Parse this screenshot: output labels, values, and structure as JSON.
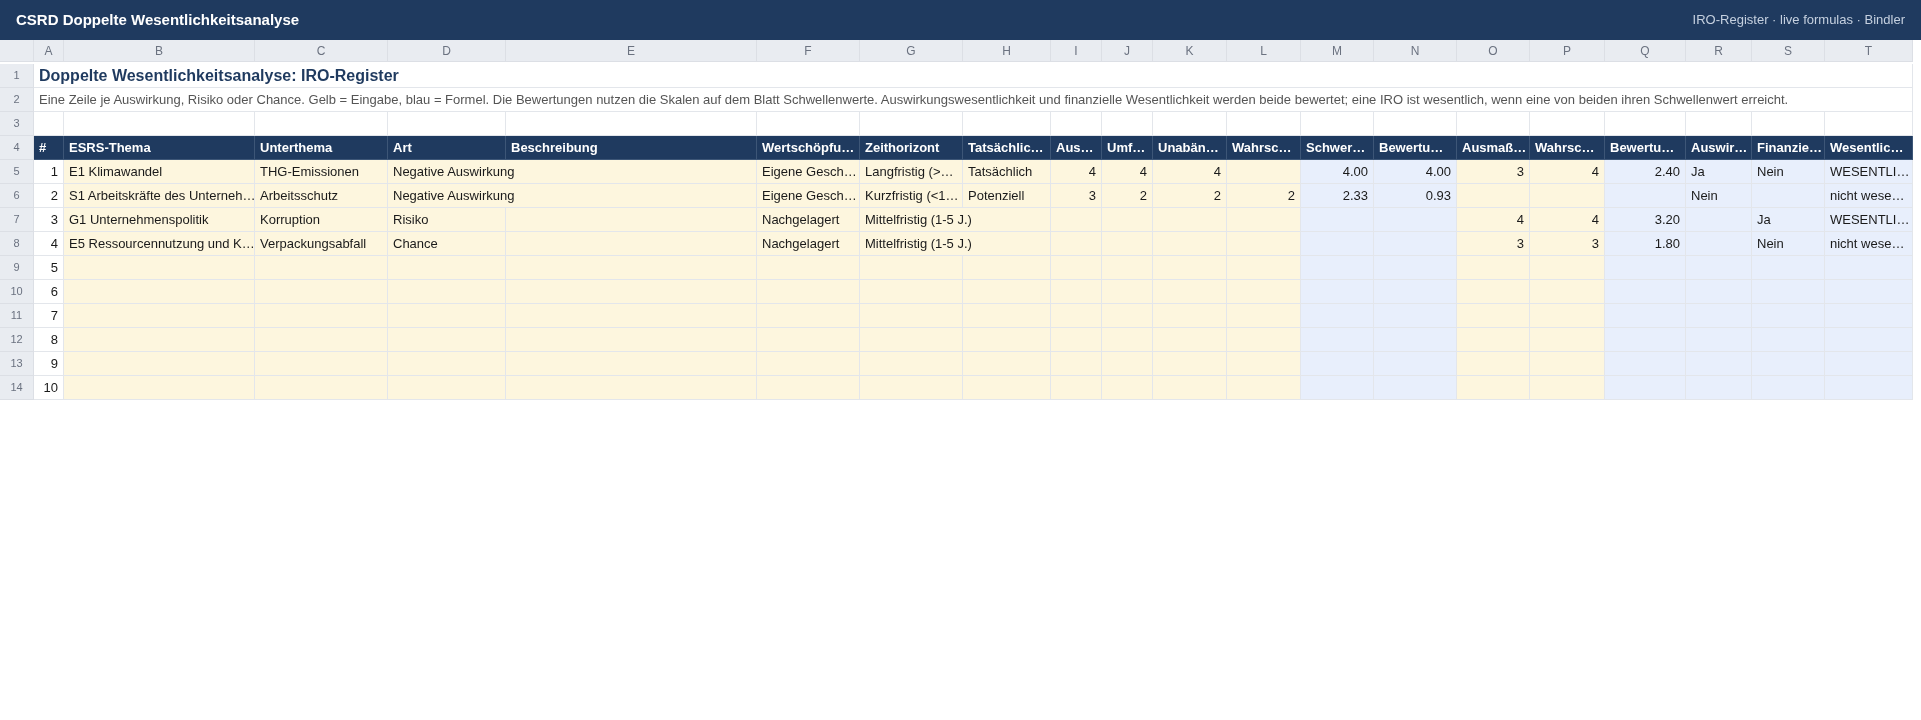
{
  "app_bar": {
    "title": "CSRD Doppelte Wesentlichkeitsanalyse",
    "subtitle": "IRO-Register · live formulas · Bindler"
  },
  "columns": [
    {
      "letter": "A",
      "header": "#",
      "kind": "index",
      "numeric": true
    },
    {
      "letter": "B",
      "header": "ESRS-Thema",
      "kind": "input",
      "numeric": false
    },
    {
      "letter": "C",
      "header": "Unterthema",
      "kind": "input",
      "numeric": false
    },
    {
      "letter": "D",
      "header": "Art",
      "kind": "input",
      "numeric": false
    },
    {
      "letter": "E",
      "header": "Beschreibung",
      "kind": "input",
      "numeric": false
    },
    {
      "letter": "F",
      "header": "Wertschöpfu…",
      "kind": "input",
      "numeric": false
    },
    {
      "letter": "G",
      "header": "Zeithorizont",
      "kind": "input",
      "numeric": false
    },
    {
      "letter": "H",
      "header": "Tatsächlic…",
      "kind": "input",
      "numeric": false
    },
    {
      "letter": "I",
      "header": "Aus…",
      "kind": "input",
      "numeric": true
    },
    {
      "letter": "J",
      "header": "Umf…",
      "kind": "input",
      "numeric": true
    },
    {
      "letter": "K",
      "header": "Unabän…",
      "kind": "input",
      "numeric": true
    },
    {
      "letter": "L",
      "header": "Wahrsc…",
      "kind": "input",
      "numeric": true
    },
    {
      "letter": "M",
      "header": "Schwer…",
      "kind": "formula",
      "numeric": true
    },
    {
      "letter": "N",
      "header": "Bewertu…",
      "kind": "formula",
      "numeric": true
    },
    {
      "letter": "O",
      "header": "Ausmaß…",
      "kind": "input",
      "numeric": true
    },
    {
      "letter": "P",
      "header": "Wahrsc…",
      "kind": "input",
      "numeric": true
    },
    {
      "letter": "Q",
      "header": "Bewertu…",
      "kind": "formula",
      "numeric": true
    },
    {
      "letter": "R",
      "header": "Auswir…",
      "kind": "formula",
      "numeric": false
    },
    {
      "letter": "S",
      "header": "Finanzie…",
      "kind": "formula",
      "numeric": false
    },
    {
      "letter": "T",
      "header": "Wesentlic…",
      "kind": "formula",
      "numeric": false
    }
  ],
  "top_rows": [
    {
      "number": "1",
      "kind": "title",
      "text": "Doppelte Wesentlichkeitsanalyse: IRO-Register"
    },
    {
      "number": "2",
      "kind": "note",
      "text": "Eine Zeile je Auswirkung, Risiko oder Chance. Gelb = Eingabe, blau = Formel. Die Bewertungen nutzen die Skalen auf dem Blatt Schwellenwerte. Auswirkungswesentlichkeit und finanzielle Wesentlichkeit werden beide bewertet; eine IRO ist wesentlich, wenn eine von beiden ihren Schwellenwert erreicht."
    },
    {
      "number": "3",
      "kind": "blank"
    },
    {
      "number": "4",
      "kind": "header"
    }
  ],
  "rows": [
    {
      "number": "5",
      "cells": {
        "A": "1",
        "B": "E1 Klimawandel",
        "C": "THG-Emissionen",
        "D": "Negative Auswirkung",
        "F": "Eigene Gesch…",
        "G": "Langfristig (>…",
        "H": "Tatsächlich",
        "I": "4",
        "J": "4",
        "K": "4",
        "M": "4.00",
        "N": "4.00",
        "O": "3",
        "P": "4",
        "Q": "2.40",
        "R": "Ja",
        "S": "Nein",
        "T": "WESENTLI…"
      }
    },
    {
      "number": "6",
      "cells": {
        "A": "2",
        "B": "S1 Arbeitskräfte des Unterneh…",
        "C": "Arbeitsschutz",
        "D": "Negative Auswirkung",
        "F": "Eigene Gesch…",
        "G": "Kurzfristig (<1…",
        "H": "Potenziell",
        "I": "3",
        "J": "2",
        "K": "2",
        "L": "2",
        "M": "2.33",
        "N": "0.93",
        "R": "Nein",
        "T": "nicht wese…"
      }
    },
    {
      "number": "7",
      "cells": {
        "A": "3",
        "B": "G1 Unternehmenspolitik",
        "C": "Korruption",
        "D": "Risiko",
        "F": "Nachgelagert",
        "G": "Mittelfristig (1-5 J.)",
        "O": "4",
        "P": "4",
        "Q": "3.20",
        "S": "Ja",
        "T": "WESENTLI…"
      }
    },
    {
      "number": "8",
      "cells": {
        "A": "4",
        "B": "E5 Ressourcennutzung und K…",
        "C": "Verpackungsabfall",
        "D": "Chance",
        "F": "Nachgelagert",
        "G": "Mittelfristig (1-5 J.)",
        "O": "3",
        "P": "3",
        "Q": "1.80",
        "S": "Nein",
        "T": "nicht wese…"
      }
    },
    {
      "number": "9",
      "cells": {
        "A": "5"
      }
    },
    {
      "number": "10",
      "cells": {
        "A": "6"
      }
    },
    {
      "number": "11",
      "cells": {
        "A": "7"
      }
    },
    {
      "number": "12",
      "cells": {
        "A": "8"
      }
    },
    {
      "number": "13",
      "cells": {
        "A": "9"
      }
    },
    {
      "number": "14",
      "cells": {
        "A": "10"
      }
    }
  ]
}
